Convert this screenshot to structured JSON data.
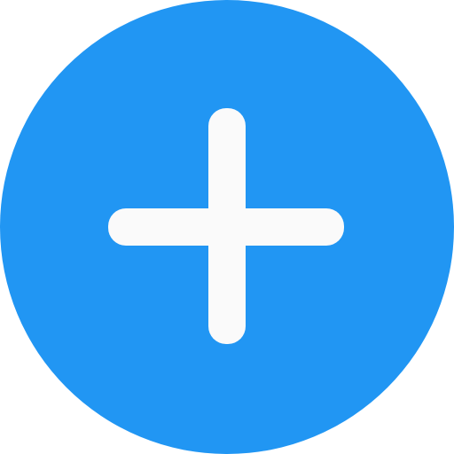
{
  "button": {
    "icon": "plus-icon",
    "label": ""
  },
  "colors": {
    "circle": "#2196f3",
    "plus": "#fafafa",
    "background": "#ffffff"
  }
}
